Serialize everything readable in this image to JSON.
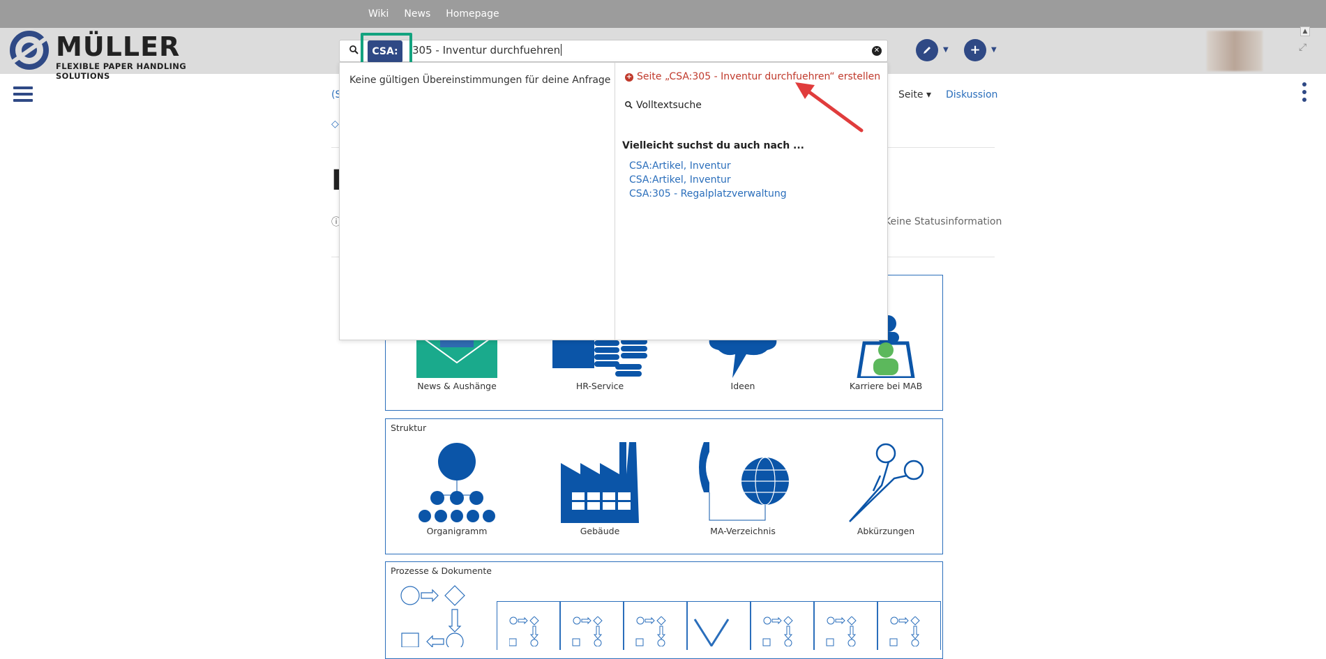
{
  "topnav": {
    "links": [
      "Wiki",
      "News",
      "Homepage"
    ]
  },
  "logo": {
    "name": "MÜLLER",
    "tagline": "FLEXIBLE PAPER HANDLING SOLUTIONS"
  },
  "search": {
    "namespace_badge": "CSA:",
    "query": "305 - Inventur durchfuehren",
    "dropdown": {
      "no_matches": "Keine gültigen Übereinstimmungen für deine Anfrage",
      "create_page": "Seite „CSA:305 - Inventur durchfuehren“ erstellen",
      "fulltext": "Volltextsuche",
      "suggestions_heading": "Vielleicht suchst du auch nach ...",
      "suggestions": [
        "CSA:Artikel, Inventur",
        "CSA:Artikel, Inventur",
        "CSA:305 - Regalplatzverwaltung"
      ]
    }
  },
  "page_actions": {
    "seite": "Seite",
    "diskussion": "Diskussion",
    "status": "Keine Statusinformation"
  },
  "left_fragments": {
    "a": "(S",
    "b": "◇",
    "c": "I",
    "d": "ⓘ"
  },
  "sections": {
    "top_tiles": [
      "News & Aushänge",
      "HR-Service",
      "Ideen",
      "Karriere bei MAB"
    ],
    "struktur": {
      "title": "Struktur",
      "tiles": [
        "Organigramm",
        "Gebäude",
        "MA-Verzeichnis",
        "Abkürzungen"
      ]
    },
    "prozesse": {
      "title": "Prozesse & Dokumente"
    }
  },
  "colors": {
    "brand_blue": "#2f4985",
    "link": "#2a6ebb",
    "highlight": "#14a37f",
    "red": "#c0392b",
    "teal": "#1aaa8c"
  },
  "icons": [
    "search-icon",
    "clear-icon",
    "edit-icon",
    "add-icon",
    "menu-icon",
    "kebab-icon",
    "expand-icon"
  ]
}
